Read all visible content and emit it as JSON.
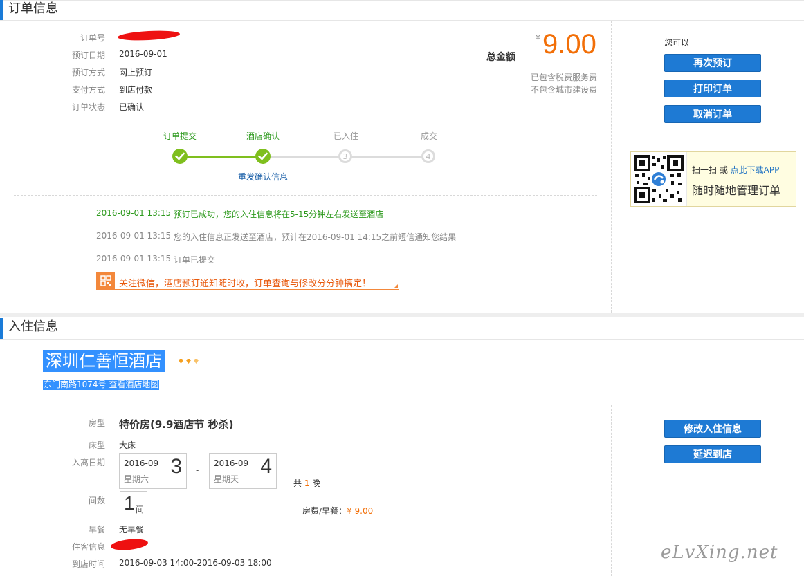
{
  "order_section": {
    "title": "订单信息",
    "fields": [
      {
        "label": "订单号",
        "value": ""
      },
      {
        "label": "预订日期",
        "value": "2016-09-01"
      },
      {
        "label": "预订方式",
        "value": "网上预订"
      },
      {
        "label": "支付方式",
        "value": "到店付款"
      },
      {
        "label": "订单状态",
        "value": "已确认"
      }
    ],
    "total": {
      "label": "总金额",
      "currency": "¥",
      "amount": "9.00",
      "note1": "已包含税费服务费",
      "note2": "不包含城市建设费"
    },
    "progress": {
      "steps": [
        {
          "label": "订单提交",
          "state": "done",
          "num": ""
        },
        {
          "label": "酒店确认",
          "state": "done",
          "num": ""
        },
        {
          "label": "已入住",
          "state": "todo",
          "num": "3"
        },
        {
          "label": "成交",
          "state": "todo",
          "num": "4"
        }
      ],
      "resend_link": "重发确认信息"
    },
    "logs": [
      {
        "time": "2016-09-01 13:15",
        "text": "预订已成功，您的入住信息将在5-15分钟左右发送至酒店"
      },
      {
        "time": "2016-09-01 13:15",
        "text": "您的入住信息正发送至酒店，预计在2016-09-01 14:15之前短信通知您结果"
      },
      {
        "time": "2016-09-01 13:15",
        "text": "订单已提交"
      }
    ],
    "wechat_promo": "关注微信，酒店预订通知随时收，订单查询与修改分分钟搞定！"
  },
  "actions": {
    "heading": "您可以",
    "rebook": "再次预订",
    "print": "打印订单",
    "cancel": "取消订单"
  },
  "app_promo": {
    "line1_prefix": "扫一扫 或 ",
    "line1_link": "点此下载APP",
    "line2": "随时随地管理订单"
  },
  "checkin_section": {
    "title": "入住信息",
    "hotel_name": "深圳仁善恒酒店",
    "hotel_address": "东门南路1074号 查看酒店地图",
    "room_type_label": "房型",
    "room_type": "特价房(9.9酒店节 秒杀)",
    "bed_label": "床型",
    "bed": "大床",
    "dates_label": "入离日期",
    "checkin": {
      "ym": "2016-09",
      "weekday": "星期六",
      "day": "3"
    },
    "date_sep": "-",
    "checkout": {
      "ym": "2016-09",
      "weekday": "星期天",
      "day": "4"
    },
    "nights_prefix": "共 ",
    "nights": "1",
    "nights_suffix": " 晚",
    "rooms_label": "间数",
    "rooms": "1",
    "rooms_unit": "间",
    "price_label": "房费/早餐：",
    "price": "¥ 9.00",
    "breakfast_label": "早餐",
    "breakfast": "无早餐",
    "guest_label": "住客信息",
    "guest": "",
    "arrival_label": "到店时间",
    "arrival": "2016-09-03 14:00-2016-09-03 18:00",
    "modify_button": "修改入住信息",
    "delay_button": "延迟到店"
  },
  "watermark": "eLvXing.net",
  "colors": {
    "accent": "#1e7ad4",
    "price": "#f26f08",
    "success": "#2e9a1e",
    "highlight": "#3391ff"
  }
}
